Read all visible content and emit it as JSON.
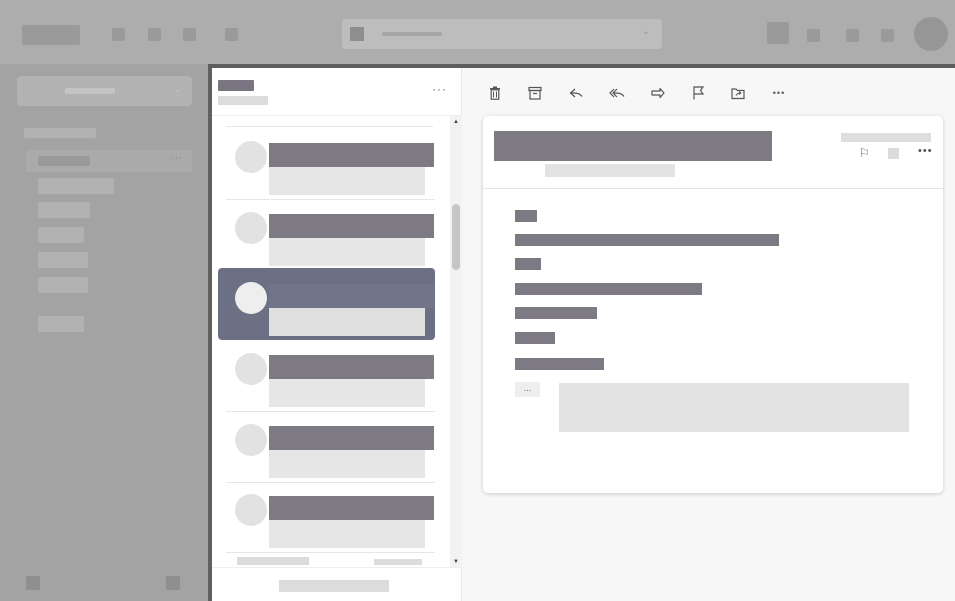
{
  "toolbar": {
    "delete_icon": "trash-icon",
    "archive_icon": "archive-icon",
    "reply_icon": "reply-icon",
    "reply_all_icon": "reply-all-icon",
    "forward_icon": "forward-icon",
    "flag_icon": "flag-icon",
    "move_icon": "move-to-folder-icon",
    "more_icon": "more-icon",
    "more_label": "•••"
  },
  "message_list": {
    "more_label": "···",
    "selected_index": 2,
    "message_count": 6
  },
  "reading_pane": {
    "card_more_label": "•••",
    "quote_toggle_label": "...",
    "flag_glyph": "⚐"
  },
  "icons": {
    "search_chevron": "chevron-down-icon",
    "scroll_up": "scroll-up-arrow",
    "scroll_down": "scroll-down-arrow"
  },
  "colors": {
    "selected_message": "#6c7085",
    "placeholder_text": "#7e7a84",
    "dim_overlay": "#9f9f9f"
  }
}
